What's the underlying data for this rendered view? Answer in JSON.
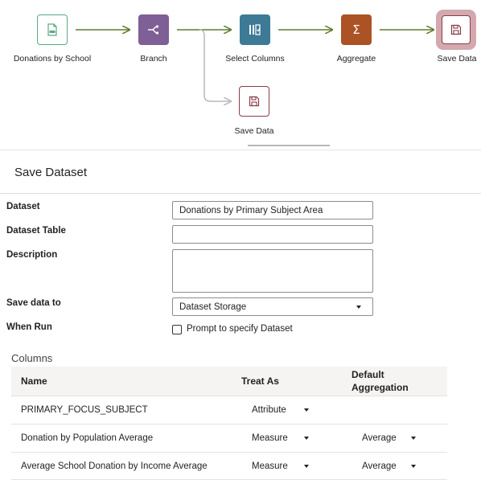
{
  "flow": {
    "nodes": [
      {
        "id": "source",
        "label": "Donations by School",
        "icon": "csv-file-icon",
        "color": "#5aa984"
      },
      {
        "id": "branch",
        "label": "Branch",
        "icon": "branch-icon",
        "color": "#7e5f96"
      },
      {
        "id": "select",
        "label": "Select Columns",
        "icon": "select-columns-icon",
        "color": "#3c7a96"
      },
      {
        "id": "aggregate",
        "label": "Aggregate",
        "icon": "sigma-icon",
        "color": "#ab5325"
      },
      {
        "id": "save1",
        "label": "Save Data",
        "icon": "save-icon",
        "color": "#8a3d4a",
        "selected": true
      },
      {
        "id": "save2",
        "label": "Save Data",
        "icon": "save-icon",
        "color": "#8a3d4a"
      }
    ],
    "aggregate_symbol": "Σ",
    "arrow_color": "#5d7b2f"
  },
  "panel": {
    "title": "Save Dataset",
    "form": {
      "dataset_label": "Dataset",
      "dataset_value": "Donations by Primary Subject Area",
      "dataset_table_label": "Dataset Table",
      "dataset_table_value": "",
      "description_label": "Description",
      "description_value": "",
      "save_to_label": "Save data to",
      "save_to_value": "Dataset Storage",
      "when_run_label": "When Run",
      "prompt_label": "Prompt to specify Dataset",
      "prompt_checked": false
    },
    "columns_title": "Columns",
    "table": {
      "headers": {
        "name": "Name",
        "treat_as": "Treat As",
        "default_aggregation_1": "Default",
        "default_aggregation_2": "Aggregation"
      },
      "rows": [
        {
          "name": "PRIMARY_FOCUS_SUBJECT",
          "treat_as": "Attribute",
          "aggregation": ""
        },
        {
          "name": "Donation by Population Average",
          "treat_as": "Measure",
          "aggregation": "Average"
        },
        {
          "name": "Average School Donation by Income Average",
          "treat_as": "Measure",
          "aggregation": "Average"
        }
      ]
    }
  }
}
